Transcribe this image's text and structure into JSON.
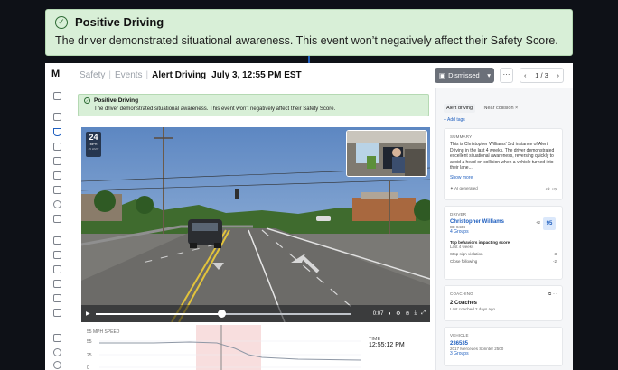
{
  "callout": {
    "title": "Positive Driving",
    "message": "The driver demonstrated situational awareness. This event won’t negatively affect their Safety Score."
  },
  "app": {
    "logo": "M",
    "breadcrumb": [
      "Safety",
      "Events"
    ],
    "page_title": "Alert Driving",
    "date_label": "July 3, 12:55 PM EST",
    "dismiss_label": "Dismissed",
    "more_label": "···",
    "pager": "1 / 3"
  },
  "banner": {
    "title": "Positive Driving",
    "message": "The driver demonstrated situational awareness. This event won’t negatively affect their Safety Score."
  },
  "video": {
    "speed": "24",
    "speed_unit": "MPH",
    "limit_label": "45 LIMIT",
    "timestamp": "0:07"
  },
  "speed_chart": {
    "label": "55 MPH SPEED",
    "y_ticks": [
      "55",
      "25",
      "0"
    ],
    "time_label": "TIME",
    "time_value": "12:55:12 PM"
  },
  "side": {
    "tags": [
      "Alert driving",
      "Near collision"
    ],
    "add_tags": "+ Add tags",
    "summary_label": "SUMMARY",
    "summary_text": "This is Christopher Williams' 3rd instance of Alert Driving in the last 4 weeks. The driver demonstrated excellent situational awareness, reversing quickly to avoid a head-on collision when a vehicle turned into their lane...",
    "show_more": "Show more",
    "ai_generated": "AI generated",
    "driver_label": "DRIVER",
    "driver_name": "Christopher Williams",
    "driver_id": "ID: 8434",
    "driver_groups": "4 Groups",
    "score_delta": "+2",
    "score": "95",
    "behaviors_title": "Top behaviors impacting score",
    "behaviors_sub": "Last 4 weeks",
    "behaviors": [
      {
        "name": "Stop sign violation",
        "value": "-3"
      },
      {
        "name": "Close following",
        "value": "-2"
      }
    ],
    "coaching_label": "COACHING",
    "coaching_title": "2 Coaches",
    "coaching_sub": "Last coached 2 days ago",
    "vehicle_label": "VEHICLE",
    "vehicle_id": "236535",
    "vehicle_model": "2017 Mercedes Sprinter 2500",
    "vehicle_groups": "3 Groups"
  }
}
